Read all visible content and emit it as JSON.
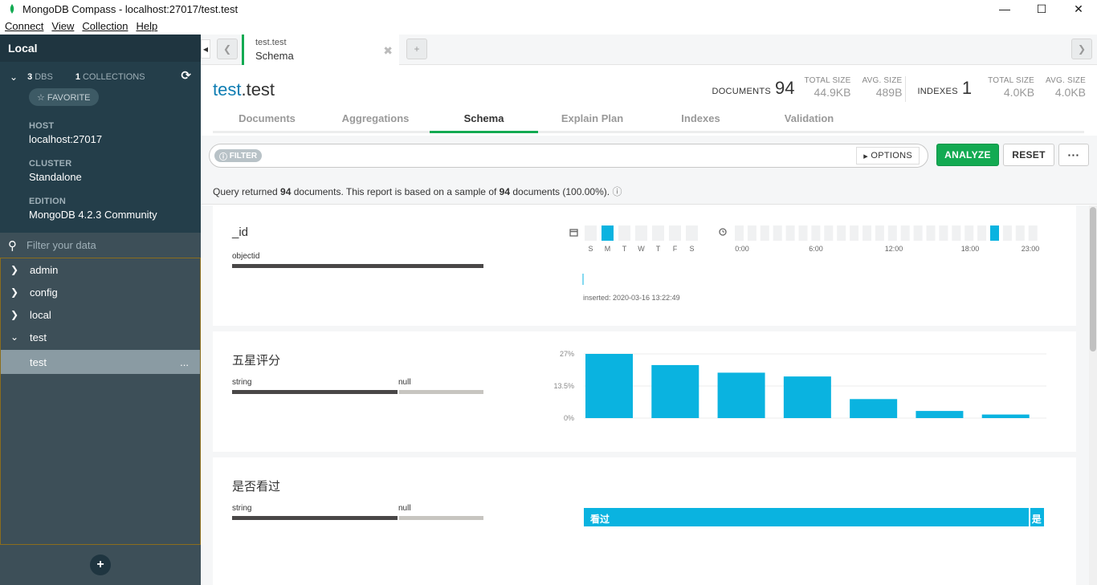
{
  "window": {
    "title": "MongoDB Compass - localhost:27017/test.test",
    "minimize": "—",
    "maximize": "☐",
    "close": "✕"
  },
  "menu": [
    "Connect",
    "View",
    "Collection",
    "Help"
  ],
  "sidebar": {
    "header": "Local",
    "dbs_count": "3",
    "dbs_label": "DBS",
    "collections_count": "1",
    "collections_label": "COLLECTIONS",
    "favorite": "☆ FAVORITE",
    "host_label": "HOST",
    "host": "localhost:27017",
    "cluster_label": "CLUSTER",
    "cluster": "Standalone",
    "edition_label": "EDITION",
    "edition": "MongoDB 4.2.3 Community",
    "filter_placeholder": "Filter your data",
    "databases": [
      {
        "name": "admin",
        "expanded": false
      },
      {
        "name": "config",
        "expanded": false
      },
      {
        "name": "local",
        "expanded": false
      },
      {
        "name": "test",
        "expanded": true
      }
    ],
    "collection": "test",
    "collection_more": "..."
  },
  "tab": {
    "namespace": "test.test",
    "subtitle": "Schema"
  },
  "header": {
    "db": "test",
    "coll": ".test",
    "documents_label": "DOCUMENTS",
    "documents": "94",
    "total_size_label": "TOTAL SIZE",
    "total_size": "44.9KB",
    "avg_size_label": "AVG. SIZE",
    "avg_size": "489B",
    "indexes_label": "INDEXES",
    "indexes": "1",
    "idx_total_size": "4.0KB",
    "idx_avg_size": "4.0KB"
  },
  "subtabs": [
    "Documents",
    "Aggregations",
    "Schema",
    "Explain Plan",
    "Indexes",
    "Validation"
  ],
  "active_subtab": "Schema",
  "query": {
    "filter_label": "FILTER",
    "options_label": "OPTIONS",
    "analyze": "ANALYZE",
    "reset": "RESET",
    "more": "···",
    "info_pre": "Query returned ",
    "returned": "94",
    "info_mid": " documents. This report is based on a sample of ",
    "sampled": "94",
    "info_post": " documents (100.00%)."
  },
  "fields": [
    {
      "name": "_id",
      "types": [
        {
          "name": "objectid",
          "fraction": 1.0,
          "color": "#494747"
        }
      ],
      "days": [
        "S",
        "M",
        "T",
        "W",
        "T",
        "F",
        "S"
      ],
      "day_highlight": 1,
      "hour_labels": [
        "0:00",
        "6:00",
        "12:00",
        "18:00",
        "23:00"
      ],
      "hour_highlight": 20,
      "inserted": "inserted: 2020-03-16 13:22:49"
    },
    {
      "name": "五星评分",
      "types": [
        {
          "name": "string",
          "fraction": 0.66,
          "color": "#494747"
        },
        {
          "name": "null",
          "fraction": 0.34,
          "color": "#c7c5c0"
        }
      ],
      "chart_data": {
        "type": "bar",
        "categories": [
          "",
          "",
          "",
          "",
          "",
          "",
          ""
        ],
        "values": [
          27,
          22.3,
          19.1,
          17.5,
          8.0,
          3.0,
          1.5
        ],
        "yticks": [
          "27%",
          "13.5%",
          "0%"
        ],
        "ylim": [
          0,
          27
        ]
      }
    },
    {
      "name": "是否看过",
      "types": [
        {
          "name": "string",
          "fraction": 0.66,
          "color": "#494747"
        },
        {
          "name": "null",
          "fraction": 0.34,
          "color": "#c7c5c0"
        }
      ],
      "values_bar": [
        {
          "label": "看过",
          "fraction": 0.97
        },
        {
          "label": "是",
          "fraction": 0.03
        }
      ]
    }
  ],
  "colors": {
    "accent": "#13aa52",
    "bar": "#0ab3e0",
    "dark_sidebar": "#243e4a"
  }
}
